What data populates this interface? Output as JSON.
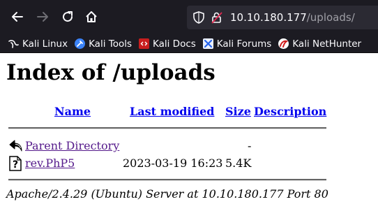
{
  "browser": {
    "url_host": "10.10.180.177",
    "url_path": "/uploads/"
  },
  "bookmarks": [
    {
      "label": "Kali Linux",
      "icon": "kali-dragon-icon",
      "color": "#000000"
    },
    {
      "label": "Kali Tools",
      "icon": "kali-tools-icon",
      "color": "#3b82f6"
    },
    {
      "label": "Kali Docs",
      "icon": "kali-docs-icon",
      "color": "#c81e1e"
    },
    {
      "label": "Kali Forums",
      "icon": "kali-forums-icon",
      "color": "#2563eb"
    },
    {
      "label": "Kali NetHunter",
      "icon": "kali-nethunter-icon",
      "color": "#d01c1c"
    }
  ],
  "page": {
    "title": "Index of /uploads",
    "columns": {
      "name": "Name",
      "last_modified": "Last modified",
      "size": "Size",
      "description": "Description"
    },
    "rows": [
      {
        "name": "Parent Directory",
        "last_modified": "",
        "size": "-",
        "icon": "back-arrow-icon",
        "visited": true
      },
      {
        "name": "rev.PhP5",
        "last_modified": "2023-03-19 16:23",
        "size": "5.4K",
        "icon": "unknown-file-icon",
        "visited": true
      }
    ],
    "address": "Apache/2.4.29 (Ubuntu) Server at 10.10.180.177 Port 80"
  },
  "colors": {
    "link": "#0000ee",
    "visited_link": "#551a8b",
    "toolbar_bg": "#1c1b22"
  }
}
